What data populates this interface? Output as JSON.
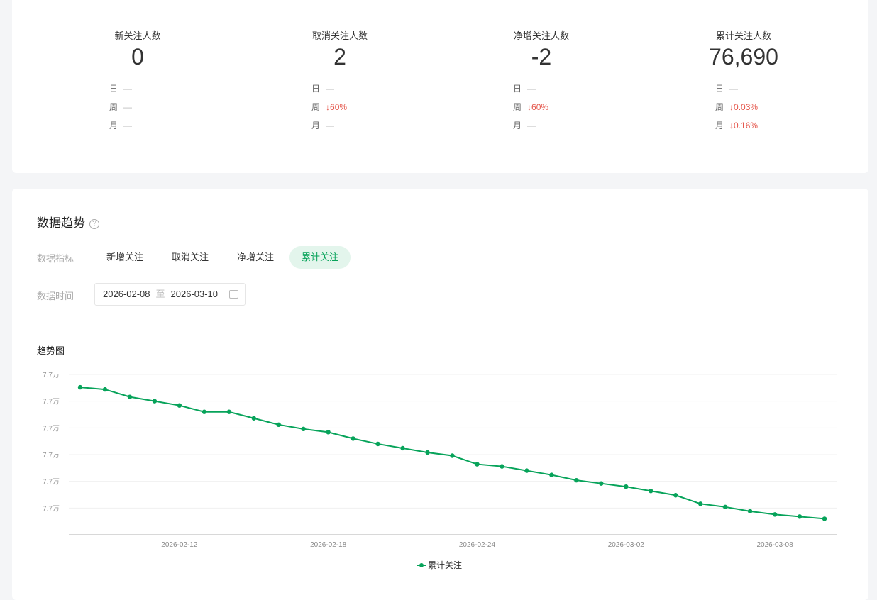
{
  "stats": [
    {
      "label": "新关注人数",
      "value": "0",
      "rows": [
        {
          "k": "日",
          "v": "—",
          "down": false
        },
        {
          "k": "周",
          "v": "—",
          "down": false
        },
        {
          "k": "月",
          "v": "—",
          "down": false
        }
      ]
    },
    {
      "label": "取消关注人数",
      "value": "2",
      "rows": [
        {
          "k": "日",
          "v": "—",
          "down": false
        },
        {
          "k": "周",
          "v": "↓60%",
          "down": true
        },
        {
          "k": "月",
          "v": "—",
          "down": false
        }
      ]
    },
    {
      "label": "净增关注人数",
      "value": "-2",
      "rows": [
        {
          "k": "日",
          "v": "—",
          "down": false
        },
        {
          "k": "周",
          "v": "↓60%",
          "down": true
        },
        {
          "k": "月",
          "v": "—",
          "down": false
        }
      ]
    },
    {
      "label": "累计关注人数",
      "value": "76,690",
      "rows": [
        {
          "k": "日",
          "v": "—",
          "down": false
        },
        {
          "k": "周",
          "v": "↓0.03%",
          "down": true
        },
        {
          "k": "月",
          "v": "↓0.16%",
          "down": true
        }
      ]
    }
  ],
  "trend": {
    "title": "数据趋势",
    "help_icon": "?",
    "metric_label": "数据指标",
    "tabs": [
      "新增关注",
      "取消关注",
      "净增关注",
      "累计关注"
    ],
    "active_tab": 3,
    "time_label": "数据时间",
    "date_start": "2026-02-08",
    "date_sep": "至",
    "date_end": "2026-03-10",
    "chart_title": "趋势图"
  },
  "colors": {
    "accent": "#07a35a",
    "down": "#e5574c"
  },
  "chart_data": {
    "type": "line",
    "title": "趋势图",
    "x": [
      "2026-02-08",
      "2026-02-09",
      "2026-02-10",
      "2026-02-11",
      "2026-02-12",
      "2026-02-13",
      "2026-02-14",
      "2026-02-15",
      "2026-02-16",
      "2026-02-17",
      "2026-02-18",
      "2026-02-19",
      "2026-02-20",
      "2026-02-21",
      "2026-02-22",
      "2026-02-23",
      "2026-02-24",
      "2026-02-25",
      "2026-02-26",
      "2026-02-27",
      "2026-02-28",
      "2026-03-01",
      "2026-03-02",
      "2026-03-03",
      "2026-03-04",
      "2026-03-05",
      "2026-03-06",
      "2026-03-07",
      "2026-03-08",
      "2026-03-09",
      "2026-03-10"
    ],
    "xticks": [
      "2026-02-12",
      "2026-02-18",
      "2026-02-24",
      "2026-03-02",
      "2026-03-08"
    ],
    "series": [
      {
        "name": "累计关注",
        "values": [
          76813,
          76811,
          76804,
          76800,
          76796,
          76790,
          76790,
          76784,
          76778,
          76774,
          76771,
          76765,
          76760,
          76756,
          76752,
          76749,
          76741,
          76739,
          76735,
          76731,
          76726,
          76723,
          76720,
          76716,
          76712,
          76704,
          76701,
          76697,
          76694,
          76692,
          76690
        ]
      }
    ],
    "yticks": [
      {
        "value": 76700,
        "label": "7.7万"
      },
      {
        "value": 76725,
        "label": "7.7万"
      },
      {
        "value": 76750,
        "label": "7.7万"
      },
      {
        "value": 76775,
        "label": "7.7万"
      },
      {
        "value": 76800,
        "label": "7.7万"
      },
      {
        "value": 76825,
        "label": "7.7万"
      }
    ],
    "ylim": [
      76675,
      76825
    ],
    "grid": true,
    "legend": "bottom-center"
  }
}
